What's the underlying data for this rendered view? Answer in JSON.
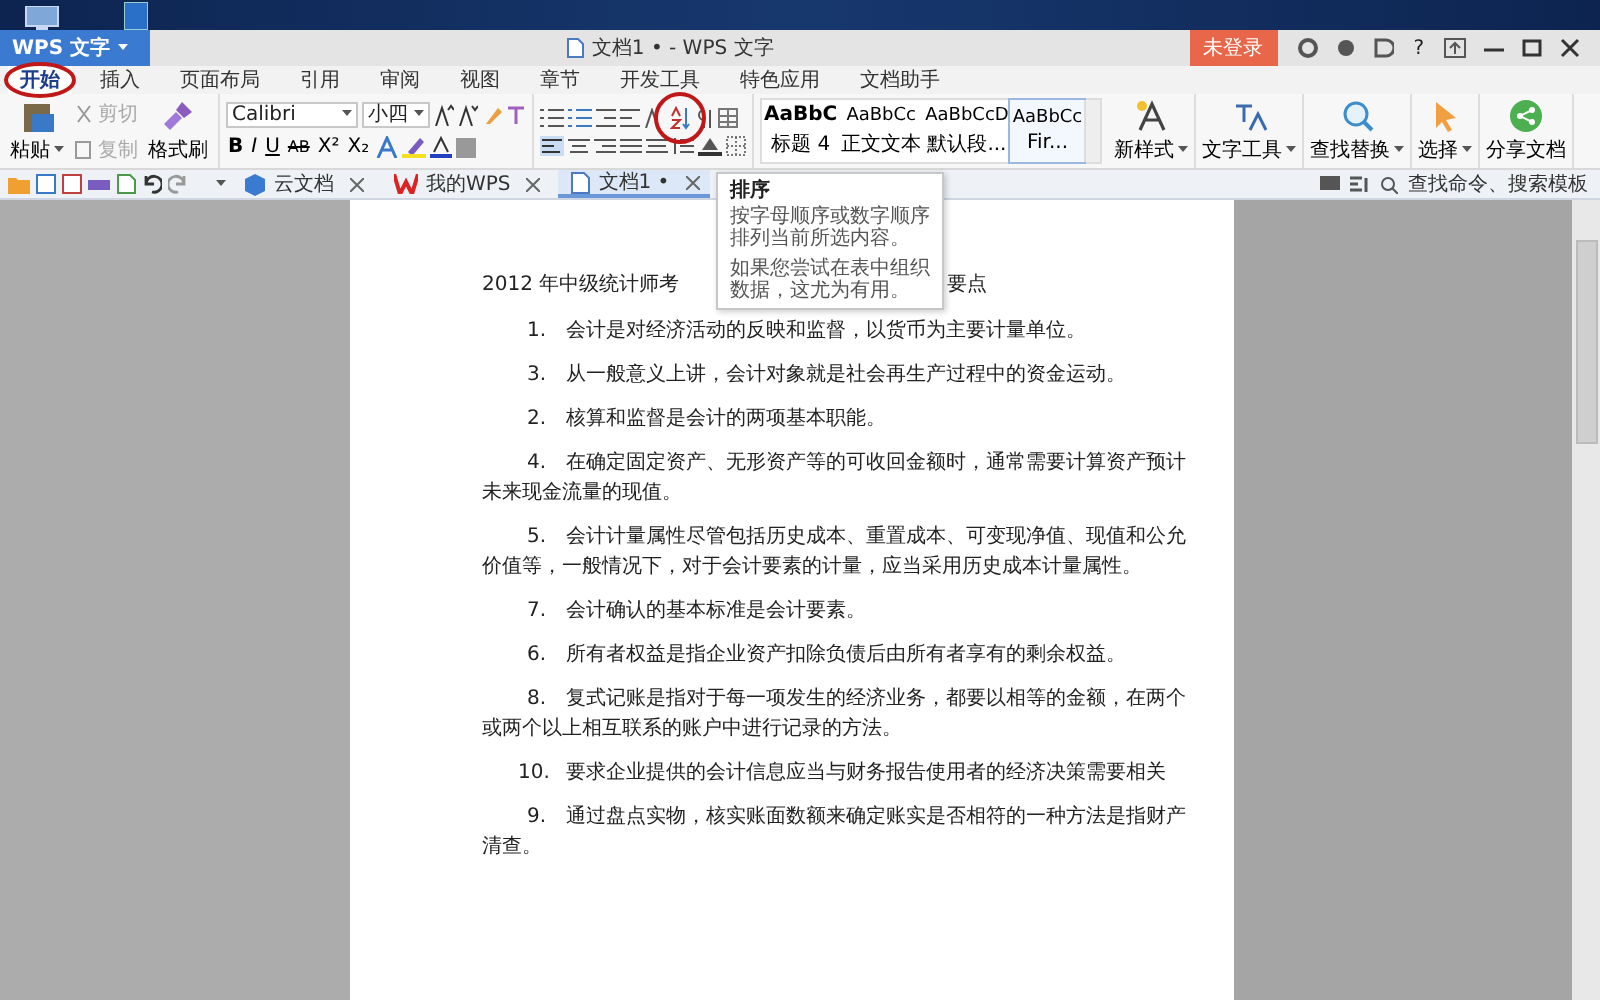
{
  "title_bar": {
    "app_menu": "WPS 文字",
    "title": "文档1 • - WPS 文字",
    "login": "未登录",
    "help": "?"
  },
  "ribbon_tabs": [
    {
      "label": "开始",
      "selected": true
    },
    {
      "label": "插入",
      "selected": false
    },
    {
      "label": "页面布局",
      "selected": false
    },
    {
      "label": "引用",
      "selected": false
    },
    {
      "label": "审阅",
      "selected": false
    },
    {
      "label": "视图",
      "selected": false
    },
    {
      "label": "章节",
      "selected": false
    },
    {
      "label": "开发工具",
      "selected": false
    },
    {
      "label": "特色应用",
      "selected": false
    },
    {
      "label": "文档助手",
      "selected": false
    }
  ],
  "clipboard": {
    "paste": "粘贴",
    "cut": {
      "label": "剪切",
      "disabled": true
    },
    "copy": {
      "label": "复制",
      "disabled": true
    },
    "format_painter": "格式刷"
  },
  "font": {
    "name": "Calibri",
    "size": "小四",
    "bold": "B",
    "italic": "I",
    "underline": "U",
    "strike": "AB",
    "superscript": "X²",
    "subscript": "X₂"
  },
  "styles": [
    {
      "sample": "AaBbC",
      "name": "标题 4",
      "selected": false
    },
    {
      "sample": "AaBbCc",
      "name": "正文文本",
      "selected": false
    },
    {
      "sample": "AaBbCcD",
      "name": "默认段...",
      "selected": false
    },
    {
      "sample": "AaBbCc",
      "name": "Fir...",
      "selected": true
    }
  ],
  "tools": [
    {
      "kind": "new-style",
      "label": "新样式",
      "dropdown": true
    },
    {
      "kind": "text-tools",
      "label": "文字工具",
      "dropdown": true
    },
    {
      "kind": "find",
      "label": "查找替换",
      "dropdown": true
    },
    {
      "kind": "select",
      "label": "选择",
      "dropdown": true
    },
    {
      "kind": "share",
      "label": "分享文档",
      "dropdown": false
    }
  ],
  "doc_tabs": [
    {
      "kind": "cloud",
      "label": "云文档",
      "selected": false
    },
    {
      "kind": "wps",
      "label": "我的WPS",
      "selected": false
    },
    {
      "kind": "doc",
      "label": "文档1 •",
      "selected": true
    }
  ],
  "search": {
    "placeholder": "查找命令、搜索模板"
  },
  "tooltip": {
    "title": "排序",
    "paragraphs": [
      {
        "lines": [
          "按字母顺序或数字顺序",
          "排列当前所选内容。"
        ]
      },
      {
        "lines": [
          "如果您尝试在表中组织",
          "数据，这尤为有用。"
        ]
      }
    ]
  },
  "document": {
    "heading_parts": [
      "2012  年中级统计师考",
      "要点"
    ],
    "paragraphs": [
      {
        "number": "1.",
        "lines": [
          "会计是对经济活动的反映和监督，以货币为主要计量单位。"
        ]
      },
      {
        "number": "3.",
        "lines": [
          "从一般意义上讲，会计对象就是社会再生产过程中的资金运动。"
        ]
      },
      {
        "number": "2.",
        "lines": [
          "核算和监督是会计的两项基本职能。"
        ]
      },
      {
        "number": "4.",
        "lines": [
          "在确定固定资产、无形资产等的可收回金额时，通常需要计算资产预计",
          "未来现金流量的现值。"
        ]
      },
      {
        "number": "5.",
        "lines": [
          "会计计量属性尽管包括历史成本、重置成本、可变现净值、现值和公允",
          "价值等，一般情况下，对于会计要素的计量，应当采用历史成本计量属性。"
        ]
      },
      {
        "number": "7.",
        "lines": [
          "会计确认的基本标准是会计要素。"
        ]
      },
      {
        "number": "6.",
        "lines": [
          "所有者权益是指企业资产扣除负债后由所有者享有的剩余权益。"
        ]
      },
      {
        "number": "8.",
        "lines": [
          "复式记账是指对于每一项发生的经济业务，都要以相等的金额，在两个",
          "或两个以上相互联系的账户中进行记录的方法。"
        ]
      },
      {
        "number": "10.",
        "lines": [
          "要求企业提供的会计信息应当与财务报告使用者的经济决策需要相关"
        ]
      },
      {
        "number": "9.",
        "lines": [
          "通过盘点实物，核实账面数额来确定账实是否相符的一种方法是指财产",
          "清查。"
        ]
      }
    ]
  }
}
